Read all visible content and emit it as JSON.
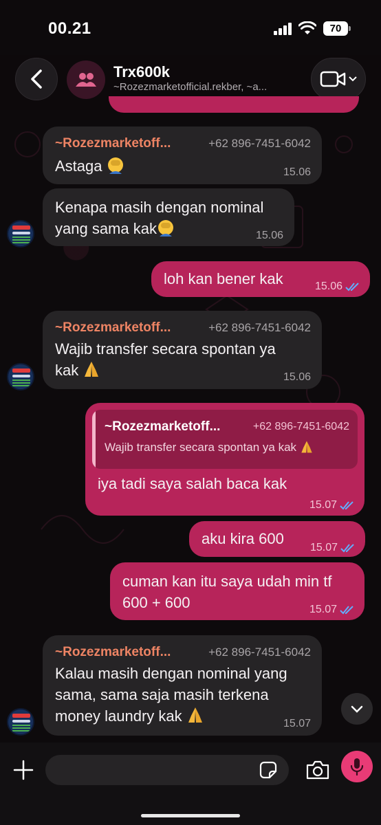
{
  "status_bar": {
    "time": "00.21",
    "battery": "70"
  },
  "header": {
    "title": "Trx600k",
    "subtitle": "~Rozezmarketofficial.rekber, ~a..."
  },
  "messages": [
    {
      "dir": "in",
      "sender": "~Rozezmarketoff...",
      "phone": "+62 896-7451-6042",
      "text": "Astaga",
      "emoji": "facepalm-emoji",
      "time": "15.06"
    },
    {
      "dir": "in",
      "text_lines": [
        "Kenapa masih dengan nominal",
        "yang sama kak"
      ],
      "emoji": "facepalm-emoji",
      "time": "15.06"
    },
    {
      "dir": "out",
      "text": "loh kan bener kak",
      "time": "15.06",
      "status": "read"
    },
    {
      "dir": "in",
      "sender": "~Rozezmarketoff...",
      "phone": "+62 896-7451-6042",
      "text_lines": [
        "Wajib transfer secara spontan ya",
        "kak"
      ],
      "emoji": "pray-emoji",
      "time": "15.06"
    },
    {
      "dir": "out",
      "quote": {
        "sender": "~Rozezmarketoff...",
        "phone": "+62 896-7451-6042",
        "text": "Wajib transfer secara spontan ya kak"
      },
      "text": "iya tadi saya salah baca kak",
      "time": "15.07",
      "status": "read"
    },
    {
      "dir": "out",
      "text": "aku kira 600",
      "time": "15.07",
      "status": "read"
    },
    {
      "dir": "out",
      "text_lines": [
        "cuman kan itu saya udah min tf",
        "600 + 600"
      ],
      "time": "15.07",
      "status": "read"
    },
    {
      "dir": "in",
      "sender": "~Rozezmarketoff...",
      "phone": "+62 896-7451-6042",
      "text_lines": [
        "Kalau masih dengan nominal yang",
        "sama, sama saja masih terkena",
        "money laundry kak"
      ],
      "emoji": "pray-emoji",
      "time": "15.07"
    }
  ],
  "composer": {
    "placeholder": ""
  },
  "icons": {
    "back": "chevron-left-icon",
    "group": "group-icon",
    "video": "video-camera-icon",
    "plus": "plus-icon",
    "sticker": "sticker-icon",
    "camera": "camera-icon",
    "mic": "microphone-icon",
    "scroll": "chevron-down-icon",
    "read": "double-check-icon"
  },
  "colors": {
    "outgoing_bubble": "#b7245a",
    "incoming_bubble": "#262426",
    "sender_name": "#ee8464",
    "read_ticks": "#5fb0ff",
    "mic_button": "#e83b76"
  }
}
